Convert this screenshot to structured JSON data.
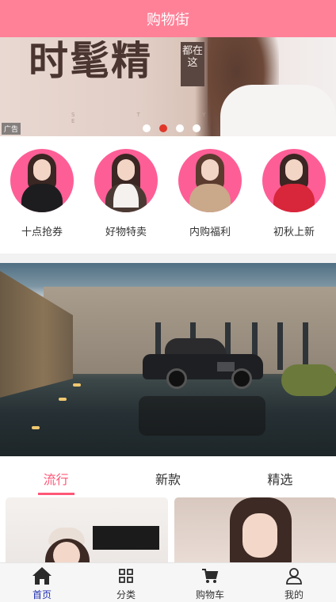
{
  "navbar": {
    "title": "购物街"
  },
  "banner": {
    "headline": "时髦精",
    "tag": "都在这",
    "ad_label": "广告",
    "letters": "S T Y L E",
    "slides_total": 4,
    "active_slide": 1
  },
  "categories": [
    {
      "label": "十点抢券",
      "outfit_color": "#1d1d1f"
    },
    {
      "label": "好物特卖",
      "outfit_color": "#4a3a33"
    },
    {
      "label": "内购福利",
      "outfit_color": "#c9a98a"
    },
    {
      "label": "初秋上新",
      "outfit_color": "#d8263a"
    }
  ],
  "tabs": [
    {
      "label": "流行",
      "active": true
    },
    {
      "label": "新款",
      "active": false
    },
    {
      "label": "精选",
      "active": false
    }
  ],
  "tabbar": [
    {
      "label": "首页",
      "icon": "home-icon",
      "active": true
    },
    {
      "label": "分类",
      "icon": "category-grid-icon",
      "active": false
    },
    {
      "label": "购物车",
      "icon": "cart-icon",
      "active": false
    },
    {
      "label": "我的",
      "icon": "user-icon",
      "active": false
    }
  ],
  "colors": {
    "brand": "#ff8198",
    "accent": "#ff5777",
    "active_tab": "#1f2fb0"
  }
}
